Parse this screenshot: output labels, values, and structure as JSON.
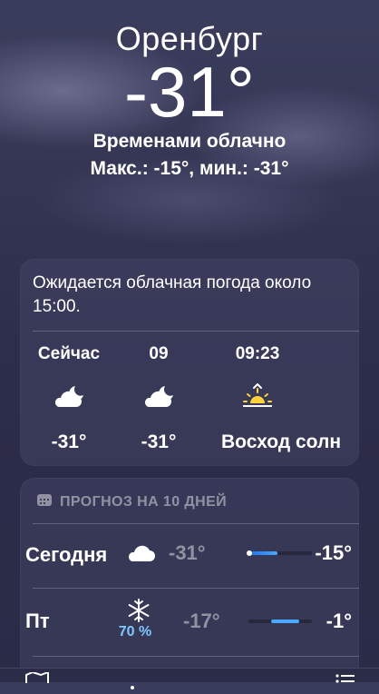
{
  "location": {
    "city": "Оренбург",
    "temperature": "-31°",
    "condition": "Временами облачно",
    "high_low": "Макс.: -15°, мин.: -31°"
  },
  "hourly": {
    "summary": "Ожидается облачная погода около 15:00.",
    "items": [
      {
        "time": "Сейчас",
        "icon": "cloudy-night-icon",
        "value": "-31°"
      },
      {
        "time": "09",
        "icon": "cloudy-night-icon",
        "value": "-31°"
      },
      {
        "time": "09:23",
        "icon": "sunrise-icon",
        "value": "Восход солн"
      }
    ]
  },
  "forecast": {
    "title": "ПРОГНОЗ НА 10 ДНЕЙ",
    "days": [
      {
        "day": "Сегодня",
        "icon": "cloud-icon",
        "precip": "",
        "low": "-31°",
        "high": "-15°",
        "range_start": 0.0,
        "range_end": 0.45,
        "current": 0.0
      },
      {
        "day": "Пт",
        "icon": "snowflake-icon",
        "precip": "70 %",
        "low": "-17°",
        "high": "-1°",
        "range_start": 0.35,
        "range_end": 0.8,
        "current": null
      }
    ]
  },
  "colors": {
    "bar_cold": "#1e6ff0",
    "bar_mid": "#4aa8ff",
    "precip": "#7ec7ff"
  },
  "tabbar": {
    "items": [
      "map-icon",
      "page-dots",
      "list-icon"
    ]
  }
}
